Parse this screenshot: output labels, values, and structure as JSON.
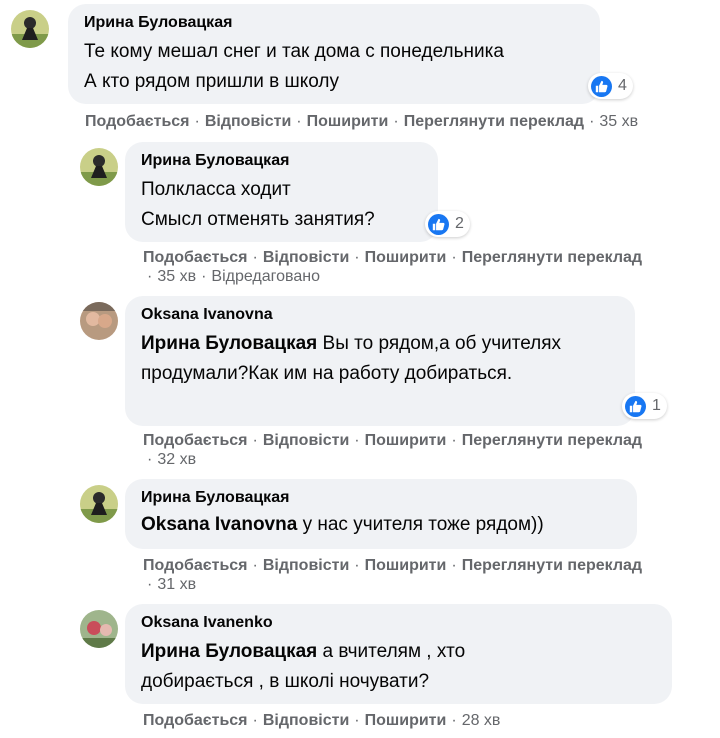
{
  "comments": [
    {
      "author": "Ирина Буловацкая",
      "text": "Те кому мешал снег и так дома с понедельника\nА кто рядом пришли в школу",
      "reactions": "4",
      "actions": {
        "like": "Подобається",
        "reply": "Відповісти",
        "share": "Поширити",
        "translate": "Переглянути переклад",
        "time": "35 хв"
      }
    },
    {
      "author": "Ирина Буловацкая",
      "text": "Полкласса ходит\nСмысл отменять занятия?",
      "reactions": "2",
      "actions": {
        "like": "Подобається",
        "reply": "Відповісти",
        "share": "Поширити",
        "translate": "Переглянути переклад",
        "time": "35 хв",
        "edited": "Відредаговано"
      }
    },
    {
      "author": "Oksana Ivanovna",
      "mention": "Ирина Буловацкая",
      "text": " Вы то рядом,а об учителях продумали?Как им на работу добираться.",
      "reactions": "1",
      "actions": {
        "like": "Подобається",
        "reply": "Відповісти",
        "share": "Поширити",
        "translate": "Переглянути переклад",
        "time": "32 хв"
      }
    },
    {
      "author": "Ирина Буловацкая",
      "mention": "Oksana Ivanovna",
      "text": " у нас учителя тоже рядом))",
      "actions": {
        "like": "Подобається",
        "reply": "Відповісти",
        "share": "Поширити",
        "translate": "Переглянути переклад",
        "time": "31 хв"
      }
    },
    {
      "author": "Oksana Ivanenko",
      "mention": "Ирина Буловацкая",
      "text": " а вчителям , хто добирається , в школі ночувати?",
      "actions": {
        "like": "Подобається",
        "reply": "Відповісти",
        "share": "Поширити",
        "time": "28 хв"
      }
    }
  ],
  "colors": {
    "bubble": "#f0f2f5",
    "meta": "#65676b",
    "like": "#1877f2"
  }
}
